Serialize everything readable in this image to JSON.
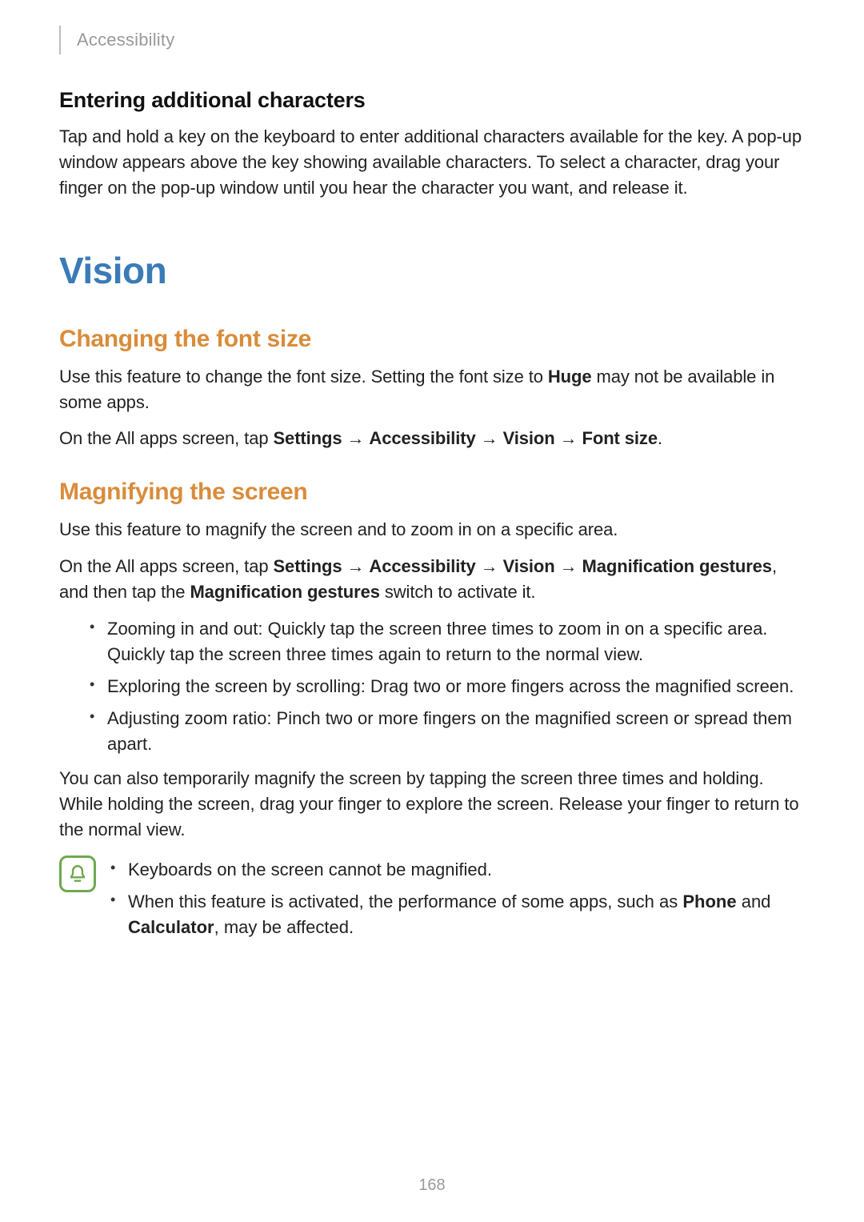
{
  "header": {
    "breadcrumb": "Accessibility"
  },
  "section1": {
    "heading": "Entering additional characters",
    "body": "Tap and hold a key on the keyboard to enter additional characters available for the key. A pop-up window appears above the key showing available characters. To select a character, drag your finger on the pop-up window until you hear the character you want, and release it."
  },
  "h1": "Vision",
  "font_size": {
    "heading": "Changing the font size",
    "p1_a": "Use this feature to change the font size. Setting the font size to ",
    "p1_bold": "Huge",
    "p1_b": " may not be available in some apps.",
    "p2_a": "On the All apps screen, tap ",
    "p2_b1": "Settings",
    "arrow": " → ",
    "p2_b2": "Accessibility",
    "p2_b3": "Vision",
    "p2_b4": "Font size",
    "p2_end": "."
  },
  "magnify": {
    "heading": "Magnifying the screen",
    "p1": "Use this feature to magnify the screen and to zoom in on a specific area.",
    "p2_a": "On the All apps screen, tap ",
    "p2_b1": "Settings",
    "p2_b2": "Accessibility",
    "p2_b3": "Vision",
    "p2_b4": "Magnification gestures",
    "p2_mid": ", and then tap the ",
    "p2_b5": "Magnification gestures",
    "p2_end": " switch to activate it.",
    "bullets": [
      "Zooming in and out: Quickly tap the screen three times to zoom in on a specific area. Quickly tap the screen three times again to return to the normal view.",
      "Exploring the screen by scrolling: Drag two or more fingers across the magnified screen.",
      "Adjusting zoom ratio: Pinch two or more fingers on the magnified screen or spread them apart."
    ],
    "p3": "You can also temporarily magnify the screen by tapping the screen three times and holding. While holding the screen, drag your finger to explore the screen. Release your finger to return to the normal view."
  },
  "note": {
    "bullets": {
      "0": "Keyboards on the screen cannot be magnified.",
      "1_a": "When this feature is activated, the performance of some apps, such as ",
      "1_b1": "Phone",
      "1_mid": " and ",
      "1_b2": "Calculator",
      "1_end": ", may be affected."
    }
  },
  "page_number": "168"
}
